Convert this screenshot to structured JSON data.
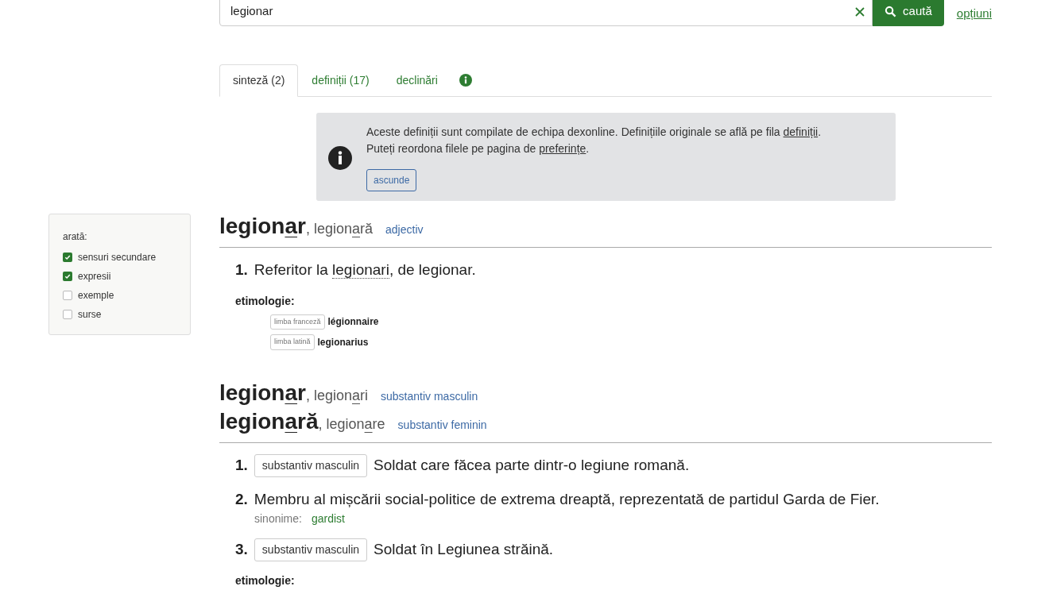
{
  "search": {
    "value": "legionar",
    "button": "caută",
    "options_link": "opțiuni"
  },
  "tabs": [
    {
      "label": "sinteză (2)",
      "selected": true
    },
    {
      "label": "definiții (17)",
      "selected": false
    },
    {
      "label": "declinări",
      "selected": false
    }
  ],
  "notice": {
    "line_1": {
      "before": "Aceste definiții sunt compilate de echipa dexonline. Definițiile originale se află pe fila ",
      "link": "definiții",
      "after": "."
    },
    "line_2": {
      "before": "Puteți reordona filele pe pagina de ",
      "link": "preferințe",
      "after": "."
    },
    "button": "ascunde"
  },
  "filters": {
    "title": "arată:",
    "items": [
      {
        "label": "sensuri secundare",
        "checked": true
      },
      {
        "label": "expresii",
        "checked": true
      },
      {
        "label": "exemple",
        "checked": false
      },
      {
        "label": "surse",
        "checked": false
      }
    ]
  },
  "entries": [
    {
      "headwords": [
        {
          "lemma": {
            "before": "legion",
            "stress": "a",
            "after": "r"
          },
          "separator": ",",
          "form": {
            "before": "legion",
            "stress": "a",
            "after": "ră"
          },
          "pos": "adjectiv"
        }
      ],
      "senses": [
        {
          "number": "1.",
          "before": "Referitor la ",
          "link": "legionari",
          "after": ", de legionar."
        }
      ],
      "etymology": {
        "title": "etimologie:",
        "items": [
          {
            "language": "limba franceză",
            "word": "légionnaire"
          },
          {
            "language": "limba latină",
            "word": "legionarius"
          }
        ]
      }
    },
    {
      "headwords": [
        {
          "lemma": {
            "before": "legion",
            "stress": "a",
            "after": "r"
          },
          "separator": ",",
          "form": {
            "before": "legion",
            "stress": "a",
            "after": "ri"
          },
          "pos": "substantiv masculin"
        },
        {
          "lemma": {
            "before": "legion",
            "stress": "a",
            "after": "ră"
          },
          "separator": ",",
          "form": {
            "before": "legion",
            "stress": "a",
            "after": "re"
          },
          "pos": "substantiv feminin"
        }
      ],
      "senses": [
        {
          "number": "1.",
          "tag": "substantiv masculin",
          "before": "Soldat care făcea parte dintr-o legiune romană."
        },
        {
          "number": "2.",
          "before": "Membru al mișcării social-politice de extrema dreaptă, reprezentată de partidul Garda de Fier.",
          "synonyms_label": "sinonime:",
          "synonyms": "gardist"
        },
        {
          "number": "3.",
          "tag": "substantiv masculin",
          "before": "Soldat în Legiunea străină."
        }
      ],
      "etymology": {
        "title": "etimologie:"
      }
    }
  ]
}
